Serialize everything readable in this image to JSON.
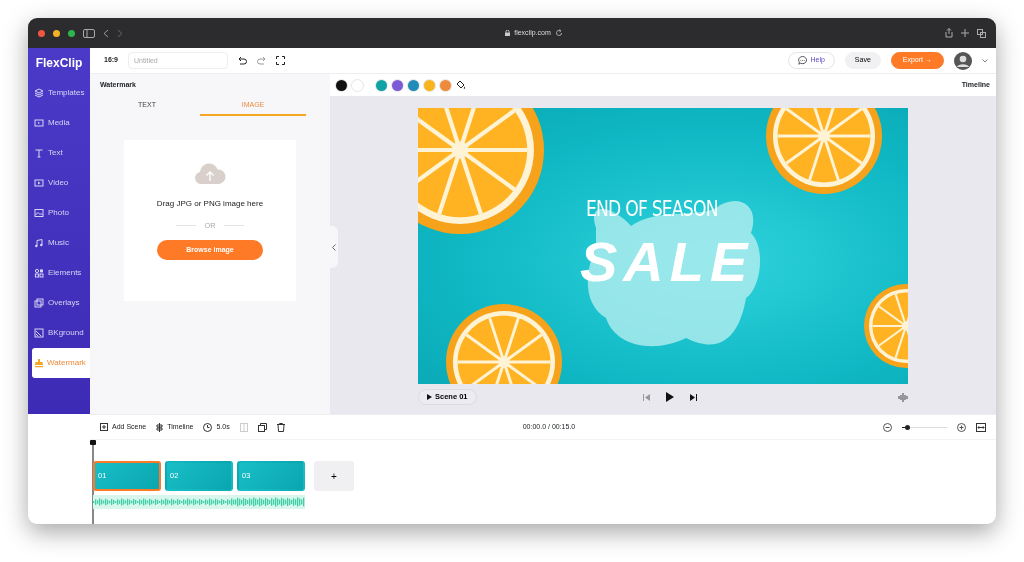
{
  "window": {
    "url": "flexclip.com"
  },
  "logo": "FlexClip",
  "sidebar": {
    "items": [
      {
        "label": "Templates",
        "selected": false
      },
      {
        "label": "Media",
        "selected": false
      },
      {
        "label": "Text",
        "selected": false
      },
      {
        "label": "Video",
        "selected": false
      },
      {
        "label": "Photo",
        "selected": false
      },
      {
        "label": "Music",
        "selected": false
      },
      {
        "label": "Elements",
        "selected": false
      },
      {
        "label": "Overlays",
        "selected": false
      },
      {
        "label": "BKground",
        "selected": false
      },
      {
        "label": "Watermark",
        "selected": true
      }
    ]
  },
  "toolbar": {
    "aspect": "16:9",
    "title_placeholder": "Untitled",
    "help": "Help",
    "save": "Save",
    "export": "Export →"
  },
  "panel": {
    "title": "Watermark",
    "tabs": [
      {
        "label": "TEXT",
        "selected": false
      },
      {
        "label": "IMAGE",
        "selected": true
      }
    ],
    "upload": {
      "prompt": "Drag JPG or PNG image here",
      "separator": "OR",
      "button": "Browse image"
    }
  },
  "colors": [
    {
      "color": "#111111"
    },
    {
      "color": "#ffffff"
    },
    {
      "color": "#0fa3a3"
    },
    {
      "color": "#7b5cd6"
    },
    {
      "color": "#1e8bb8"
    },
    {
      "color": "#f8b41c"
    },
    {
      "color": "#ee8a3c"
    }
  ],
  "timeline_label": "Timeline",
  "canvas": {
    "headline": "END OF SEASON",
    "big_text": "SALE"
  },
  "player": {
    "scene": "Scene 01"
  },
  "timeline": {
    "add_scene": "Add Scene",
    "timeline": "Timeline",
    "duration": "5.0s",
    "time": "00:00.0 / 00:15.0",
    "zoom": {
      "level": 0.12
    },
    "clips": [
      {
        "label": "01",
        "selected": true
      },
      {
        "label": "02",
        "selected": false
      },
      {
        "label": "03",
        "selected": false
      }
    ],
    "add": "+"
  }
}
